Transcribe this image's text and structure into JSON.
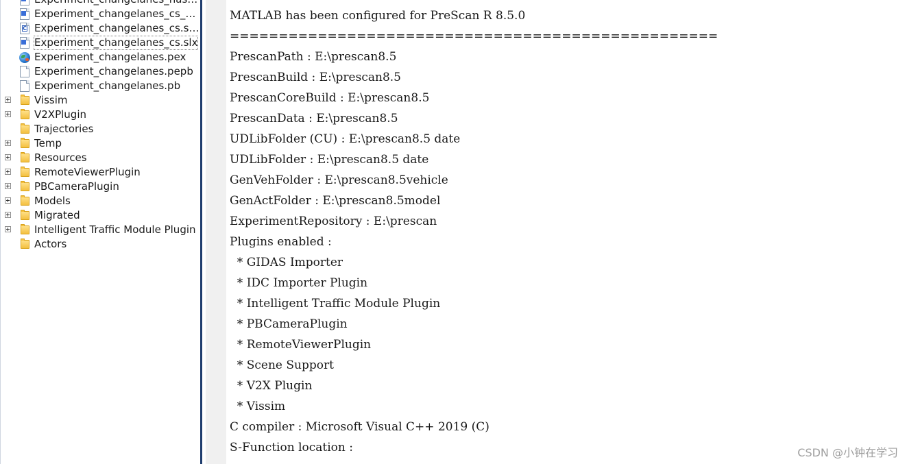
{
  "sidebar": {
    "items": [
      {
        "label": "Experiment_changelanes_hash...",
        "icon": "slx-file-icon",
        "expandable": false
      },
      {
        "label": "Experiment_changelanes_cs_old...",
        "icon": "simulink-model-icon",
        "expandable": false
      },
      {
        "label": "Experiment_changelanes_cs.slx....",
        "icon": "c-code-file-icon",
        "expandable": false
      },
      {
        "label": "Experiment_changelanes_cs.slx",
        "icon": "simulink-model-icon",
        "expandable": false,
        "selected": true
      },
      {
        "label": "Experiment_changelanes.pex",
        "icon": "globe-icon",
        "expandable": false
      },
      {
        "label": "Experiment_changelanes.pepb",
        "icon": "document-icon",
        "expandable": false
      },
      {
        "label": "Experiment_changelanes.pb",
        "icon": "document-icon",
        "expandable": false
      },
      {
        "label": "Vissim",
        "icon": "folder-icon",
        "expandable": true
      },
      {
        "label": "V2XPlugin",
        "icon": "folder-icon",
        "expandable": true
      },
      {
        "label": "Trajectories",
        "icon": "folder-icon",
        "expandable": false
      },
      {
        "label": "Temp",
        "icon": "folder-icon",
        "expandable": true
      },
      {
        "label": "Resources",
        "icon": "folder-icon",
        "expandable": true
      },
      {
        "label": "RemoteViewerPlugin",
        "icon": "folder-icon",
        "expandable": true
      },
      {
        "label": "PBCameraPlugin",
        "icon": "folder-icon",
        "expandable": true
      },
      {
        "label": "Models",
        "icon": "folder-icon",
        "expandable": true
      },
      {
        "label": "Migrated",
        "icon": "folder-icon",
        "expandable": true
      },
      {
        "label": "Intelligent Traffic Module Plugin",
        "icon": "folder-icon",
        "expandable": true
      },
      {
        "label": "Actors",
        "icon": "folder-icon",
        "expandable": false
      }
    ]
  },
  "console": {
    "lines": [
      "==================================================",
      "MATLAB has been configured for PreScan R 8.5.0",
      "==================================================",
      "PrescanPath : E:\\prescan8.5",
      "PrescanBuild : E:\\prescan8.5",
      "PrescanCoreBuild : E:\\prescan8.5",
      "PrescanData : E:\\prescan8.5",
      "UDLibFolder (CU) : E:\\prescan8.5 date",
      "UDLibFolder : E:\\prescan8.5 date",
      "GenVehFolder : E:\\prescan8.5vehicle",
      "GenActFolder : E:\\prescan8.5model",
      "ExperimentRepository : E:\\prescan",
      "Plugins enabled :",
      "  * GIDAS Importer",
      "  * IDC Importer Plugin",
      "  * Intelligent Traffic Module Plugin",
      "  * PBCameraPlugin",
      "  * RemoteViewerPlugin",
      "  * Scene Support",
      "  * V2X Plugin",
      "  * Vissim",
      "C compiler : Microsoft Visual C++ 2019 (C)",
      "S-Function location :"
    ]
  },
  "watermark": "CSDN @小钟在学习",
  "colors": {
    "divider": "#1f3d6e",
    "gutter": "#f0f0f0",
    "folder": "#f4c040"
  }
}
